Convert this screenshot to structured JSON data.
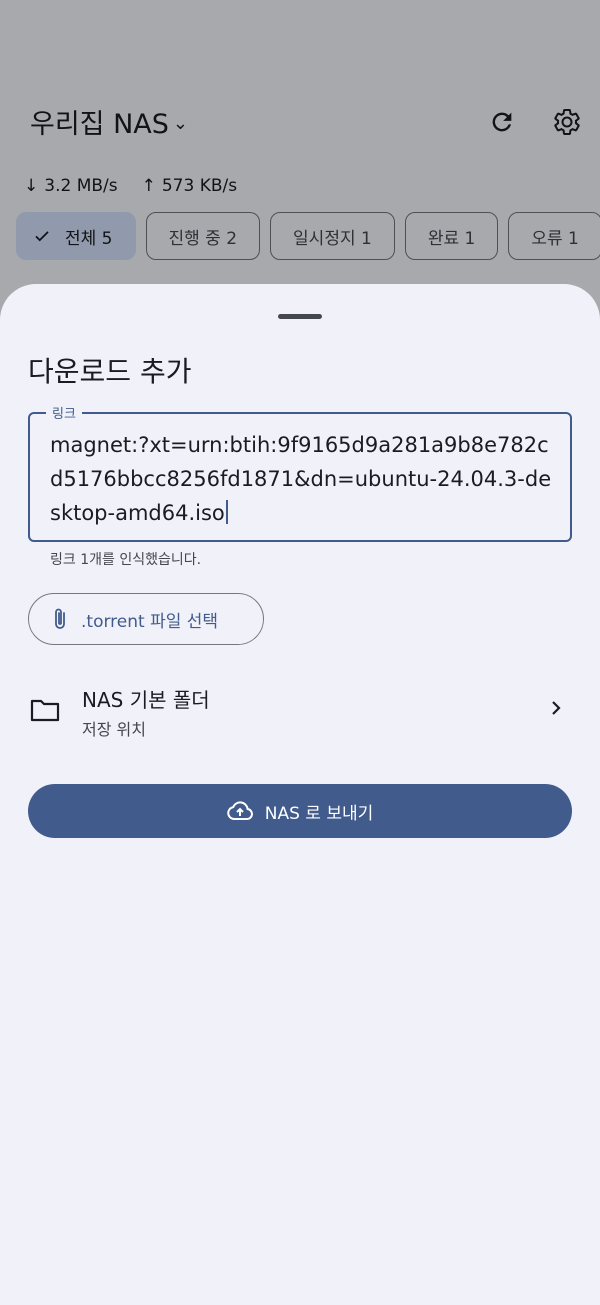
{
  "app": {
    "title": "우리집 NAS",
    "title_chevron": "⌄",
    "download_speed": "3.2 MB/s",
    "upload_speed": "573 KB/s",
    "download_arrow": "↓",
    "upload_arrow": "↑",
    "filters": [
      {
        "label": "전체 5",
        "selected": true
      },
      {
        "label": "진행 중 2",
        "selected": false
      },
      {
        "label": "일시정지 1",
        "selected": false
      },
      {
        "label": "완료 1",
        "selected": false
      },
      {
        "label": "오류 1",
        "selected": false
      }
    ],
    "icons": {
      "refresh": "refresh-icon",
      "settings": "gear-icon"
    }
  },
  "sheet": {
    "title": "다운로드 추가",
    "link_label": "링크",
    "link_value": "magnet:?xt=urn:btih:9f9165d9a281a9b8e782cd5176bbcc8256fd1871&dn=ubuntu-24.04.3-desktop-amd64.iso",
    "helper_text": "링크 1개를 인식했습니다.",
    "torrent_button": ".torrent 파일 선택",
    "folder": {
      "title": "NAS 기본 폴더",
      "subtitle": "저장 위치"
    },
    "send_button": "NAS 로 보내기"
  },
  "colors": {
    "primary": "#405b8c",
    "selected_chip": "#d6e3ff",
    "sheet_bg": "#f1f2f9",
    "text": "#1a1c21"
  }
}
